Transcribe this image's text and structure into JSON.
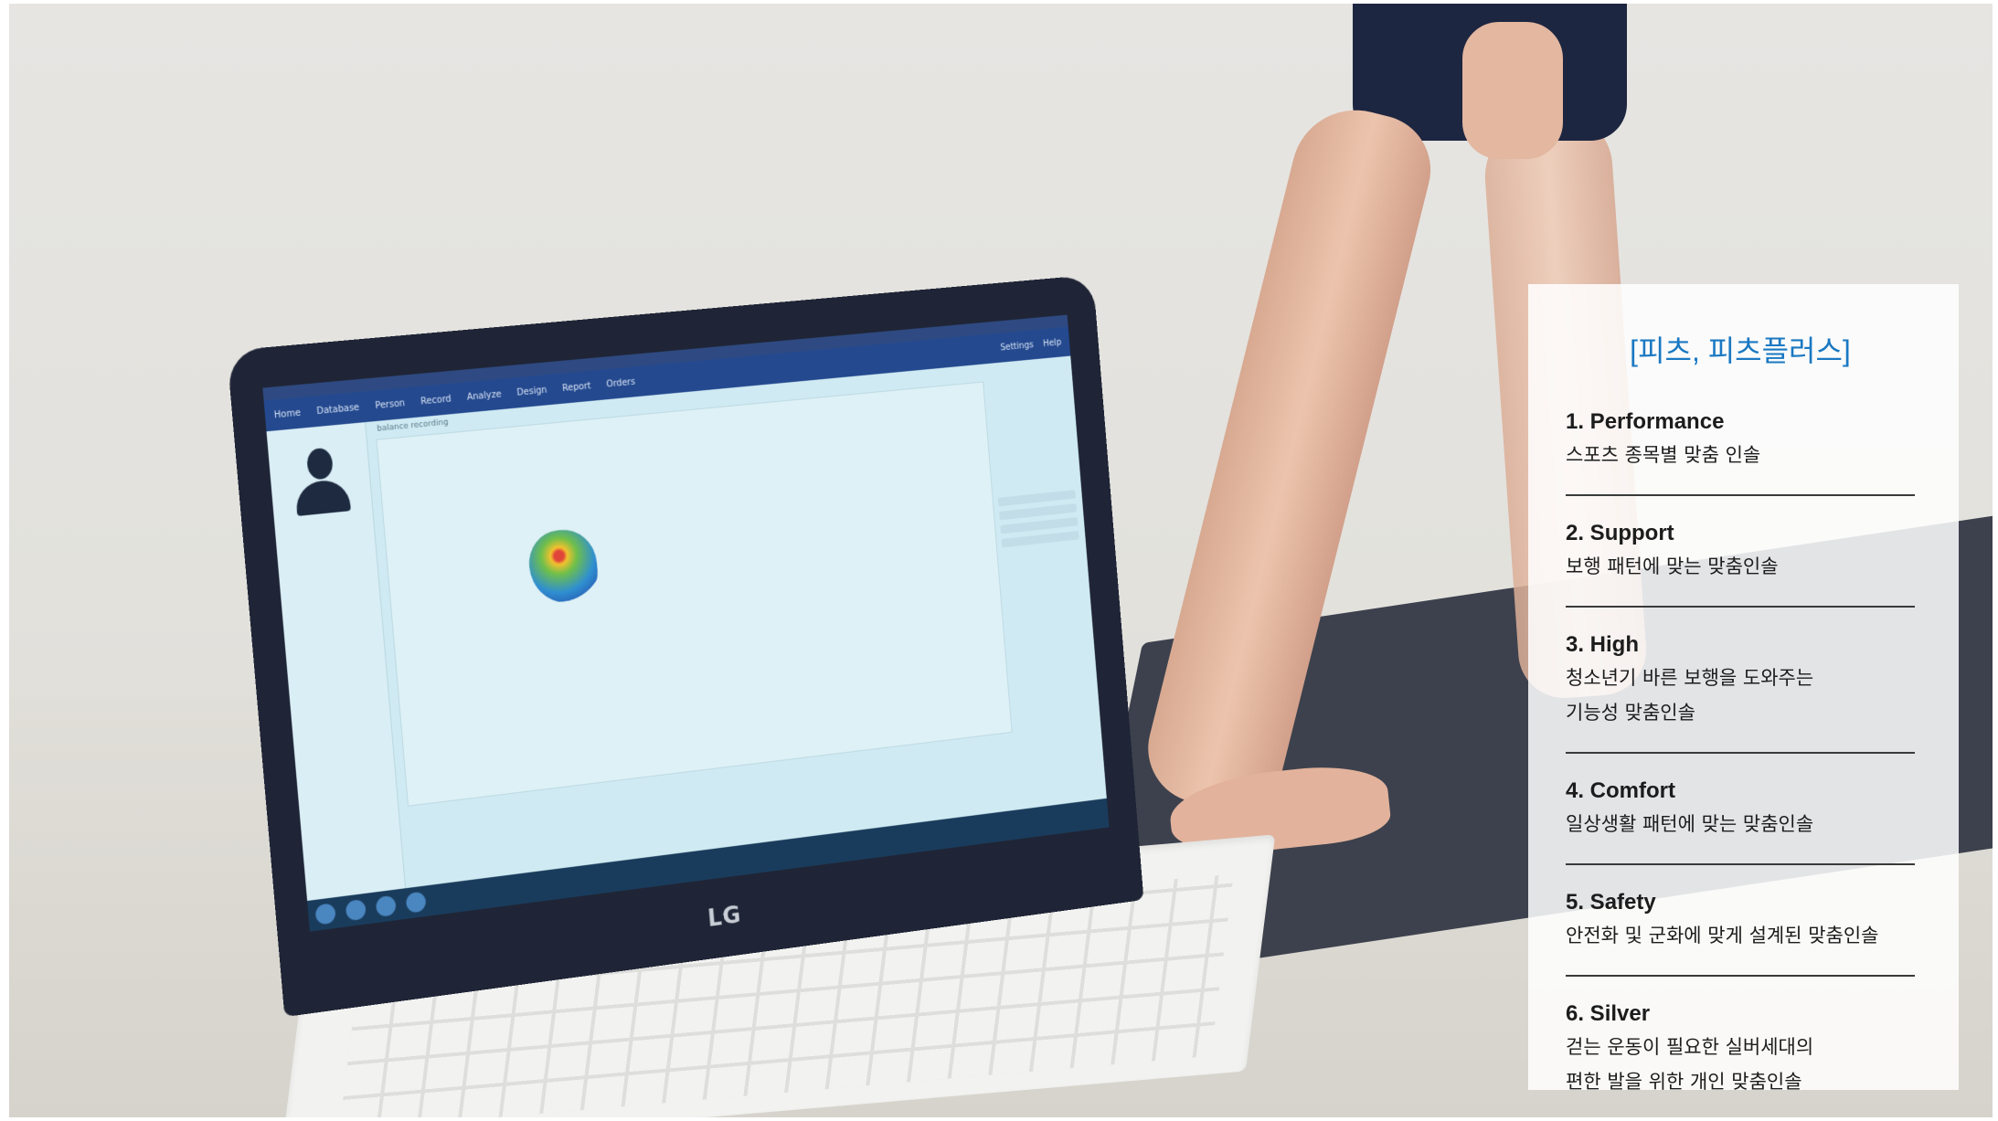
{
  "card": {
    "title": "[피츠, 피츠플러스]",
    "items": [
      {
        "heading": "1. Performance",
        "description": "스포츠 종목별 맞춤 인솔"
      },
      {
        "heading": "2. Support",
        "description": "보행 패턴에 맞는 맞춤인솔"
      },
      {
        "heading": "3. High",
        "description": "청소년기 바른 보행을 도와주는\n기능성 맞춤인솔"
      },
      {
        "heading": "4. Comfort",
        "description": "일상생활 패턴에 맞는 맞춤인솔"
      },
      {
        "heading": "5. Safety",
        "description": "안전화 및 군화에 맞게 설계된 맞춤인솔"
      },
      {
        "heading": "6. Silver",
        "description": "걷는 운동이 필요한 실버세대의\n편한 발을 위한 개인 맞춤인솔"
      }
    ]
  },
  "laptop": {
    "brand": "LG",
    "app_nav": [
      "Home",
      "Database",
      "Person",
      "Record",
      "Analyze",
      "Design",
      "Report",
      "Orders"
    ],
    "app_nav_right": [
      "Settings",
      "Help"
    ],
    "plot_label": "balance recording"
  },
  "colors": {
    "title_accent": "#1a78c2",
    "divider": "#3a3a3a",
    "app_nav_bg": "#24498f"
  }
}
